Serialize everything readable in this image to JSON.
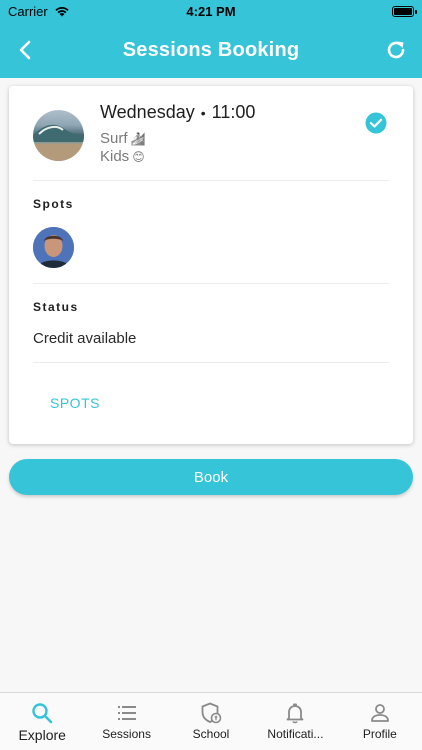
{
  "status_bar": {
    "carrier": "Carrier",
    "time": "4:21 PM"
  },
  "header": {
    "title": "Sessions Booking",
    "back_icon": "chevron-left-icon",
    "refresh_icon": "refresh-icon"
  },
  "session": {
    "day": "Wednesday",
    "separator": "•",
    "time": "11:00",
    "sport": "Surf",
    "sport_icon": "🏄",
    "level": "Kids",
    "level_icon": "😊",
    "selected": true
  },
  "spots_section": {
    "label": "Spots"
  },
  "status_section": {
    "label": "Status",
    "value": "Credit available"
  },
  "spots_link": "SPOTS",
  "book_button": "Book",
  "tabs": [
    {
      "label": "Explore",
      "icon": "search-icon",
      "active": true
    },
    {
      "label": "Sessions",
      "icon": "list-icon",
      "active": false
    },
    {
      "label": "School",
      "icon": "school-shield-icon",
      "active": false
    },
    {
      "label": "Notificati...",
      "icon": "bell-icon",
      "active": false
    },
    {
      "label": "Profile",
      "icon": "person-icon",
      "active": false
    }
  ],
  "colors": {
    "accent": "#35c4d8",
    "background": "#f7f7f7",
    "card": "#ffffff"
  }
}
